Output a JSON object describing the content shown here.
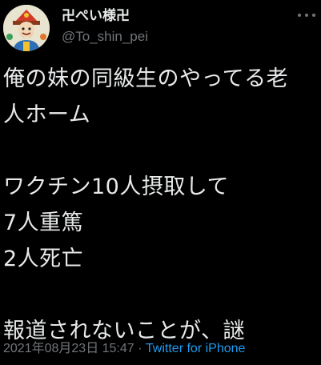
{
  "user": {
    "display_name": "卍ぺい様卍",
    "handle": "@To_shin_pei"
  },
  "tweet": {
    "lines": [
      "俺の妹の同級生のやってる老",
      "人ホーム",
      "",
      "ワクチン10人摂取して",
      "7人重篤",
      "2人死亡",
      "",
      "報道されないことが、謎"
    ],
    "timestamp": "2021年08月23日 15:47",
    "separator": " · ",
    "source": "Twitter for iPhone"
  },
  "icons": {
    "more": "more-horizontal-icon"
  },
  "colors": {
    "background": "#000000",
    "text": "#e7e9ea",
    "secondary": "#71767b",
    "link": "#1d9bf0"
  }
}
